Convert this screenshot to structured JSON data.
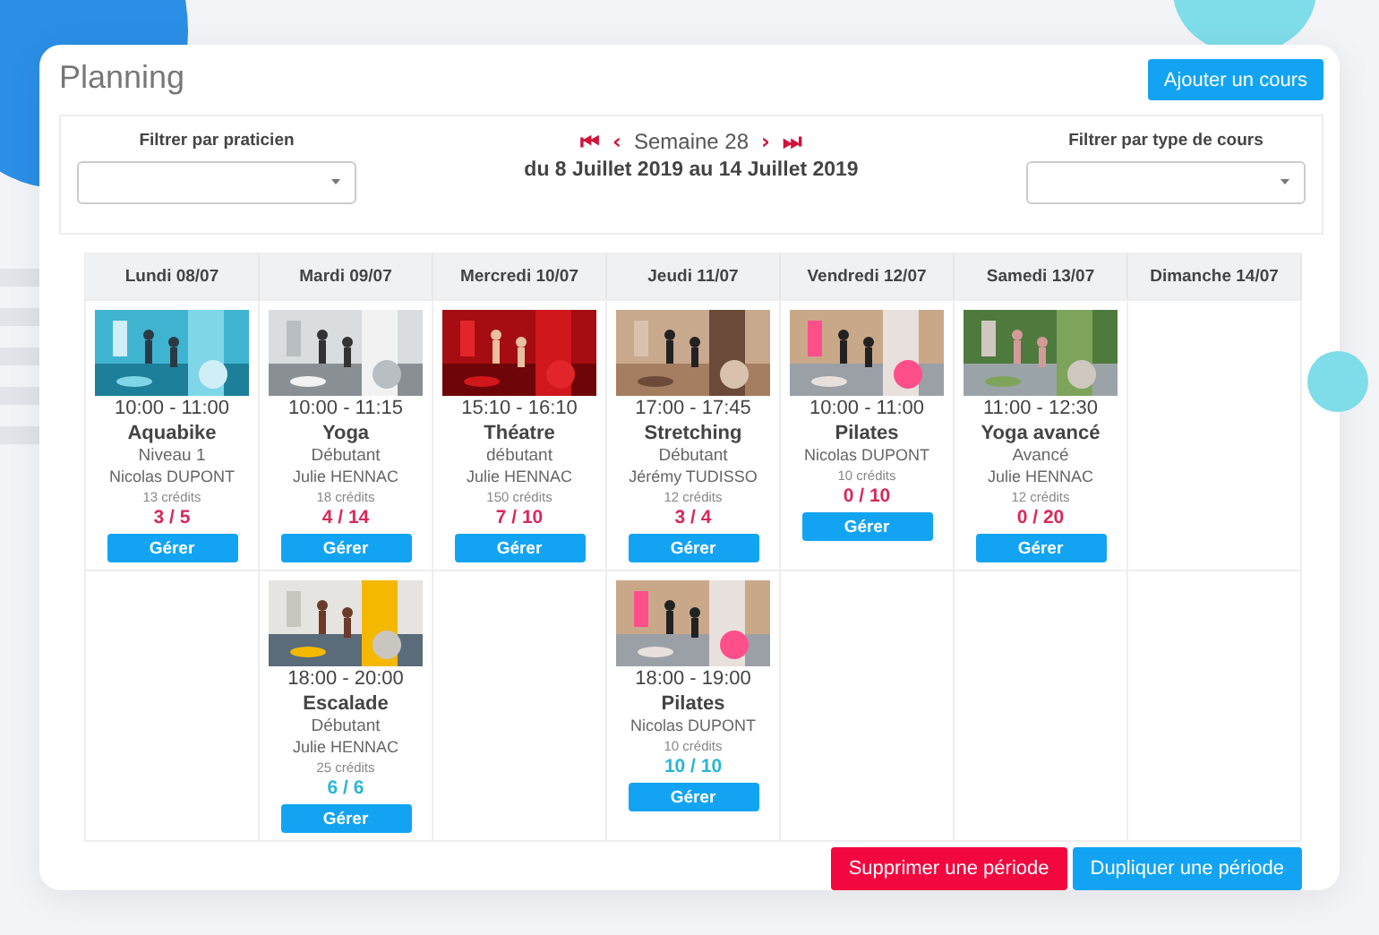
{
  "title": "Planning",
  "add_button": "Ajouter un cours",
  "filters": [
    {
      "label": "Filtrer par praticien"
    },
    {
      "label": "Filtrer par type de cours"
    }
  ],
  "week": {
    "first_icon": "⏮",
    "prev_icon": "‹",
    "label": "Semaine 28",
    "next_icon": "›",
    "last_icon": "⏭",
    "range": "du 8 Juillet 2019 au 14 Juillet 2019"
  },
  "days": [
    {
      "name": "Lundi 08/07",
      "courses": [
        {
          "kind": "picture",
          "time": "10:00 - 11:00",
          "title": "Aquabike",
          "level": "Niveau 1",
          "teacher": "Nicolas DUPONT",
          "credits": "13 crédits",
          "places": "3 / 5",
          "full": false,
          "button": "Gérer"
        }
      ]
    },
    {
      "name": "Mardi 09/07",
      "courses": [
        {
          "kind": "picture",
          "time": "10:00 - 11:15",
          "title": "Yoga",
          "level": "Débutant",
          "teacher": "Julie HENNAC",
          "credits": "18 crédits",
          "places": "4 / 14",
          "full": false,
          "button": "Gérer"
        },
        {
          "kind": "picture",
          "time": "18:00 - 20:00",
          "title": "Escalade",
          "level": "Débutant",
          "teacher": "Julie HENNAC",
          "credits": "25 crédits",
          "places": "6 / 6",
          "full": true,
          "button": "Gérer"
        }
      ]
    },
    {
      "name": "Mercredi 10/07",
      "courses": [
        {
          "kind": "picture",
          "time": "15:10 - 16:10",
          "title": "Théatre",
          "level": "débutant",
          "teacher": "Julie HENNAC",
          "credits": "150 crédits",
          "places": "7 / 10",
          "full": false,
          "button": "Gérer"
        }
      ]
    },
    {
      "name": "Jeudi 11/07",
      "courses": [
        {
          "kind": "picture",
          "time": "17:00 - 17:45",
          "title": "Stretching",
          "level": "Débutant",
          "teacher": "Jérémy TUDISSO",
          "credits": "12 crédits",
          "places": "3 / 4",
          "full": false,
          "button": "Gérer"
        },
        {
          "kind": "picture",
          "time": "18:00 - 19:00",
          "title": "Pilates",
          "teacher": "Nicolas DUPONT",
          "credits": "10 crédits",
          "places": "10 / 10",
          "full": true,
          "button": "Gérer"
        }
      ]
    },
    {
      "name": "Vendredi 12/07",
      "courses": [
        {
          "kind": "picture",
          "time": "10:00 - 11:00",
          "title": "Pilates",
          "teacher": "Nicolas DUPONT",
          "credits": "10 crédits",
          "places": "0 / 10",
          "full": false,
          "button": "Gérer"
        }
      ]
    },
    {
      "name": "Samedi 13/07",
      "courses": [
        {
          "kind": "picture",
          "time": "11:00 - 12:30",
          "title": "Yoga avancé",
          "level": "Avancé",
          "teacher": "Julie HENNAC",
          "credits": "12 crédits",
          "places": "0 / 20",
          "full": false,
          "button": "Gérer"
        }
      ]
    },
    {
      "name": "Dimanche 14/07"
    }
  ],
  "footer_buttons": [
    {
      "kind": "danger",
      "label": "Supprimer une période"
    },
    {
      "kind": "primary",
      "label": "Dupliquer une période"
    }
  ]
}
